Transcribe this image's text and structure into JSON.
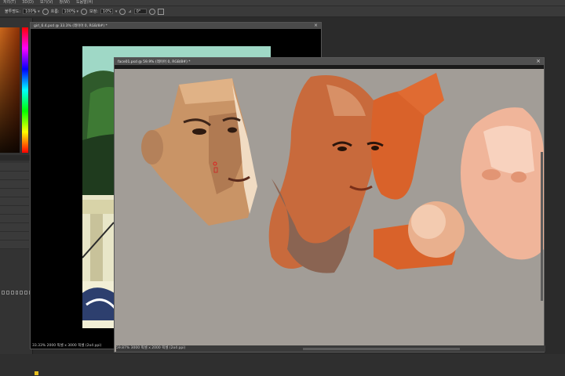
{
  "menubar": {
    "items": [
      "처리(T)",
      "3D(D)",
      "보기(V)",
      "창(W)",
      "도움말(H)"
    ]
  },
  "options_bar": {
    "opacity_label": "불투명도:",
    "opacity_value": "100%",
    "flow_label": "흐름:",
    "flow_value": "100%",
    "smoothing_label": "보정:",
    "smoothing_value": "10%",
    "angle_value": "0°"
  },
  "window_back": {
    "title": "girl_6.4.psd @ 33.3% (레이어 0, RGB/8#) *",
    "zoom": "33.33%",
    "doc_info": "2000 픽셀 x 3000 픽셀 (2o4 ppi)"
  },
  "window_front": {
    "title": "face01.psd @ 59.9% (레이어 0, RGB/8#) *",
    "zoom": "59.87%",
    "doc_info": "3000 픽셀 x 2000 픽셀 (2o4 ppi)"
  },
  "colors": {
    "canvas_gray": "#a29d97",
    "accent_orange": "#d9622a",
    "skin_tan": "#c99466",
    "peach": "#f0b59a"
  }
}
